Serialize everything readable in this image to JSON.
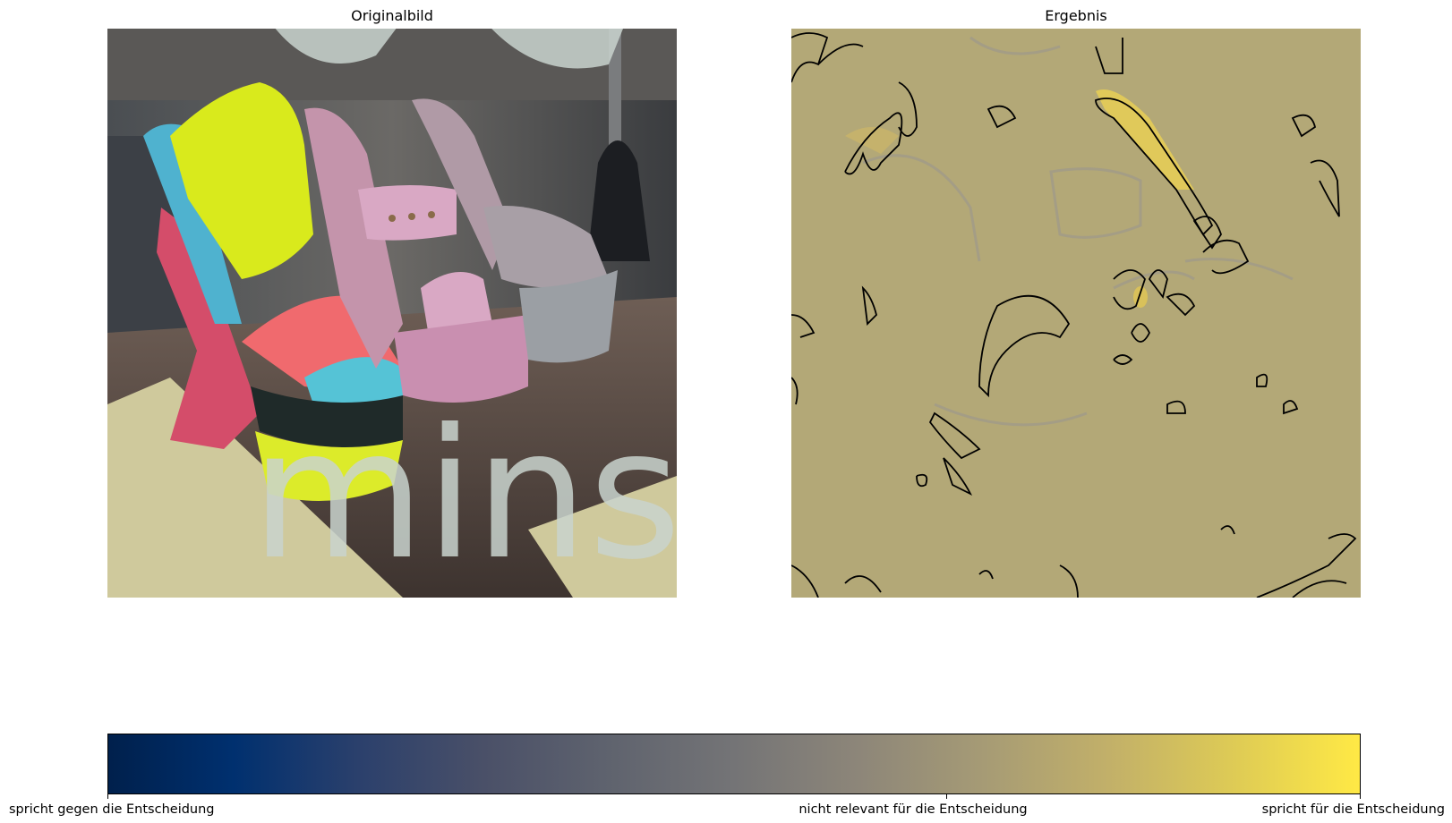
{
  "left_panel": {
    "title": "Originalbild",
    "window_text": "minsi"
  },
  "right_panel": {
    "title": "Ergebnis"
  },
  "colorbar": {
    "label_left": "spricht gegen die Entscheidung",
    "label_mid": "nicht relevant für die Entscheidung",
    "label_right": "spricht für die Entscheidung"
  },
  "colors": {
    "map_low": "#00204c",
    "map_mid": "#747476",
    "map_high": "#ffe945",
    "result_background": "#b3a877"
  }
}
